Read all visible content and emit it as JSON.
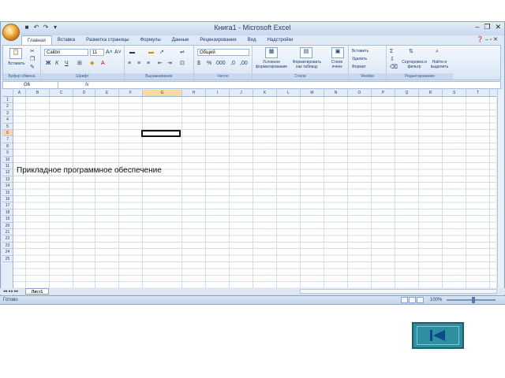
{
  "window": {
    "title": "Книга1 - Microsoft Excel",
    "office_button": "☼",
    "controls": [
      "–",
      "❐",
      "✕"
    ]
  },
  "ribbon_tabs": [
    {
      "label": "Главная",
      "active": true
    },
    {
      "label": "Вставка"
    },
    {
      "label": "Разметка страницы"
    },
    {
      "label": "Формулы"
    },
    {
      "label": "Данные"
    },
    {
      "label": "Рецензирование"
    },
    {
      "label": "Вид"
    },
    {
      "label": "Надстройки"
    }
  ],
  "ribbon": {
    "clipboard": {
      "label": "Буфер обмена",
      "paste": "Вставить"
    },
    "font": {
      "label": "Шрифт",
      "font_name": "Calibri",
      "font_size": "11"
    },
    "alignment": {
      "label": "Выравнивание"
    },
    "number": {
      "label": "Число",
      "format": "Общий"
    },
    "styles": {
      "label": "Стили",
      "cond_format": "Условное форматирование",
      "format_table": "Форматировать как таблицу",
      "cell_styles": "Стили ячеек"
    },
    "cells": {
      "label": "Ячейки",
      "insert": "Вставить",
      "delete": "Удалить",
      "format": "Формат"
    },
    "editing": {
      "label": "Редактирование",
      "sort": "Сортировка и фильтр",
      "find": "Найти и выделить"
    }
  },
  "formula_bar": {
    "name_box": "G6",
    "fx": "fx",
    "value": ""
  },
  "columns": [
    "A",
    "B",
    "C",
    "D",
    "E",
    "F",
    "G",
    "H",
    "I",
    "J",
    "K",
    "L",
    "M",
    "N",
    "O",
    "P",
    "Q",
    "R",
    "S",
    "T"
  ],
  "selected_column": "G",
  "rows": [
    "1",
    "2",
    "3",
    "4",
    "5",
    "6",
    "7",
    "8",
    "9",
    "10",
    "11",
    "12",
    "13",
    "14",
    "15",
    "16",
    "17",
    "18",
    "19",
    "20",
    "21",
    "22",
    "23",
    "24",
    "25"
  ],
  "selected_row": "6",
  "cell_A1": "Прикладное программное обеспечение",
  "sheets": {
    "active": "Лист1"
  },
  "status": {
    "ready": "Готово",
    "zoom": "100%"
  }
}
